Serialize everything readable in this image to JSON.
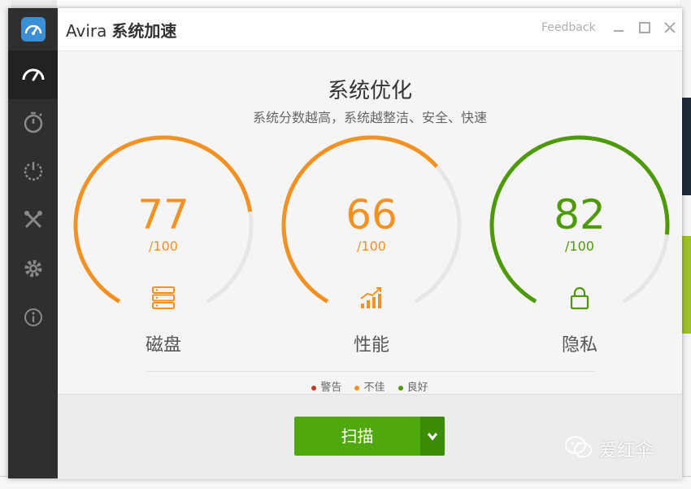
{
  "app": {
    "brand": "Avira",
    "title": "系统加速",
    "feedback_label": "Feedback"
  },
  "colors": {
    "warning": "#c0392b",
    "fair": "#f39223",
    "good": "#4e9a06",
    "track": "#e6e6e6",
    "scan_button": "#4fa80d",
    "sidebar": "#2f2f2f"
  },
  "sidebar": {
    "logo_icon": "speedometer-app-icon",
    "items": [
      {
        "icon": "gauge-icon",
        "active": true
      },
      {
        "icon": "timer-icon",
        "active": false
      },
      {
        "icon": "power-icon",
        "active": false
      },
      {
        "icon": "tools-icon",
        "active": false
      },
      {
        "icon": "gear-icon",
        "active": false
      },
      {
        "icon": "info-icon",
        "active": false
      }
    ]
  },
  "main": {
    "heading": "系统优化",
    "subheading": "系统分数越高，系统越整洁、安全、快速",
    "gauges": [
      {
        "label": "磁盘",
        "score": "77",
        "max": "/100",
        "fill": 0.77,
        "status": "fair",
        "icon": "storage-icon"
      },
      {
        "label": "性能",
        "score": "66",
        "max": "/100",
        "fill": 0.66,
        "status": "fair",
        "icon": "performance-chart-icon"
      },
      {
        "label": "隐私",
        "score": "82",
        "max": "/100",
        "fill": 0.82,
        "status": "good",
        "icon": "lock-icon"
      }
    ],
    "legend": [
      {
        "label": "警告",
        "status": "warning"
      },
      {
        "label": "不佳",
        "status": "fair"
      },
      {
        "label": "良好",
        "status": "good"
      }
    ]
  },
  "footer": {
    "scan_label": "扫描",
    "scan_dropdown_icon": "chevron-down-icon"
  },
  "watermark": {
    "text": "爱红伞",
    "icon": "wechat-icon"
  }
}
